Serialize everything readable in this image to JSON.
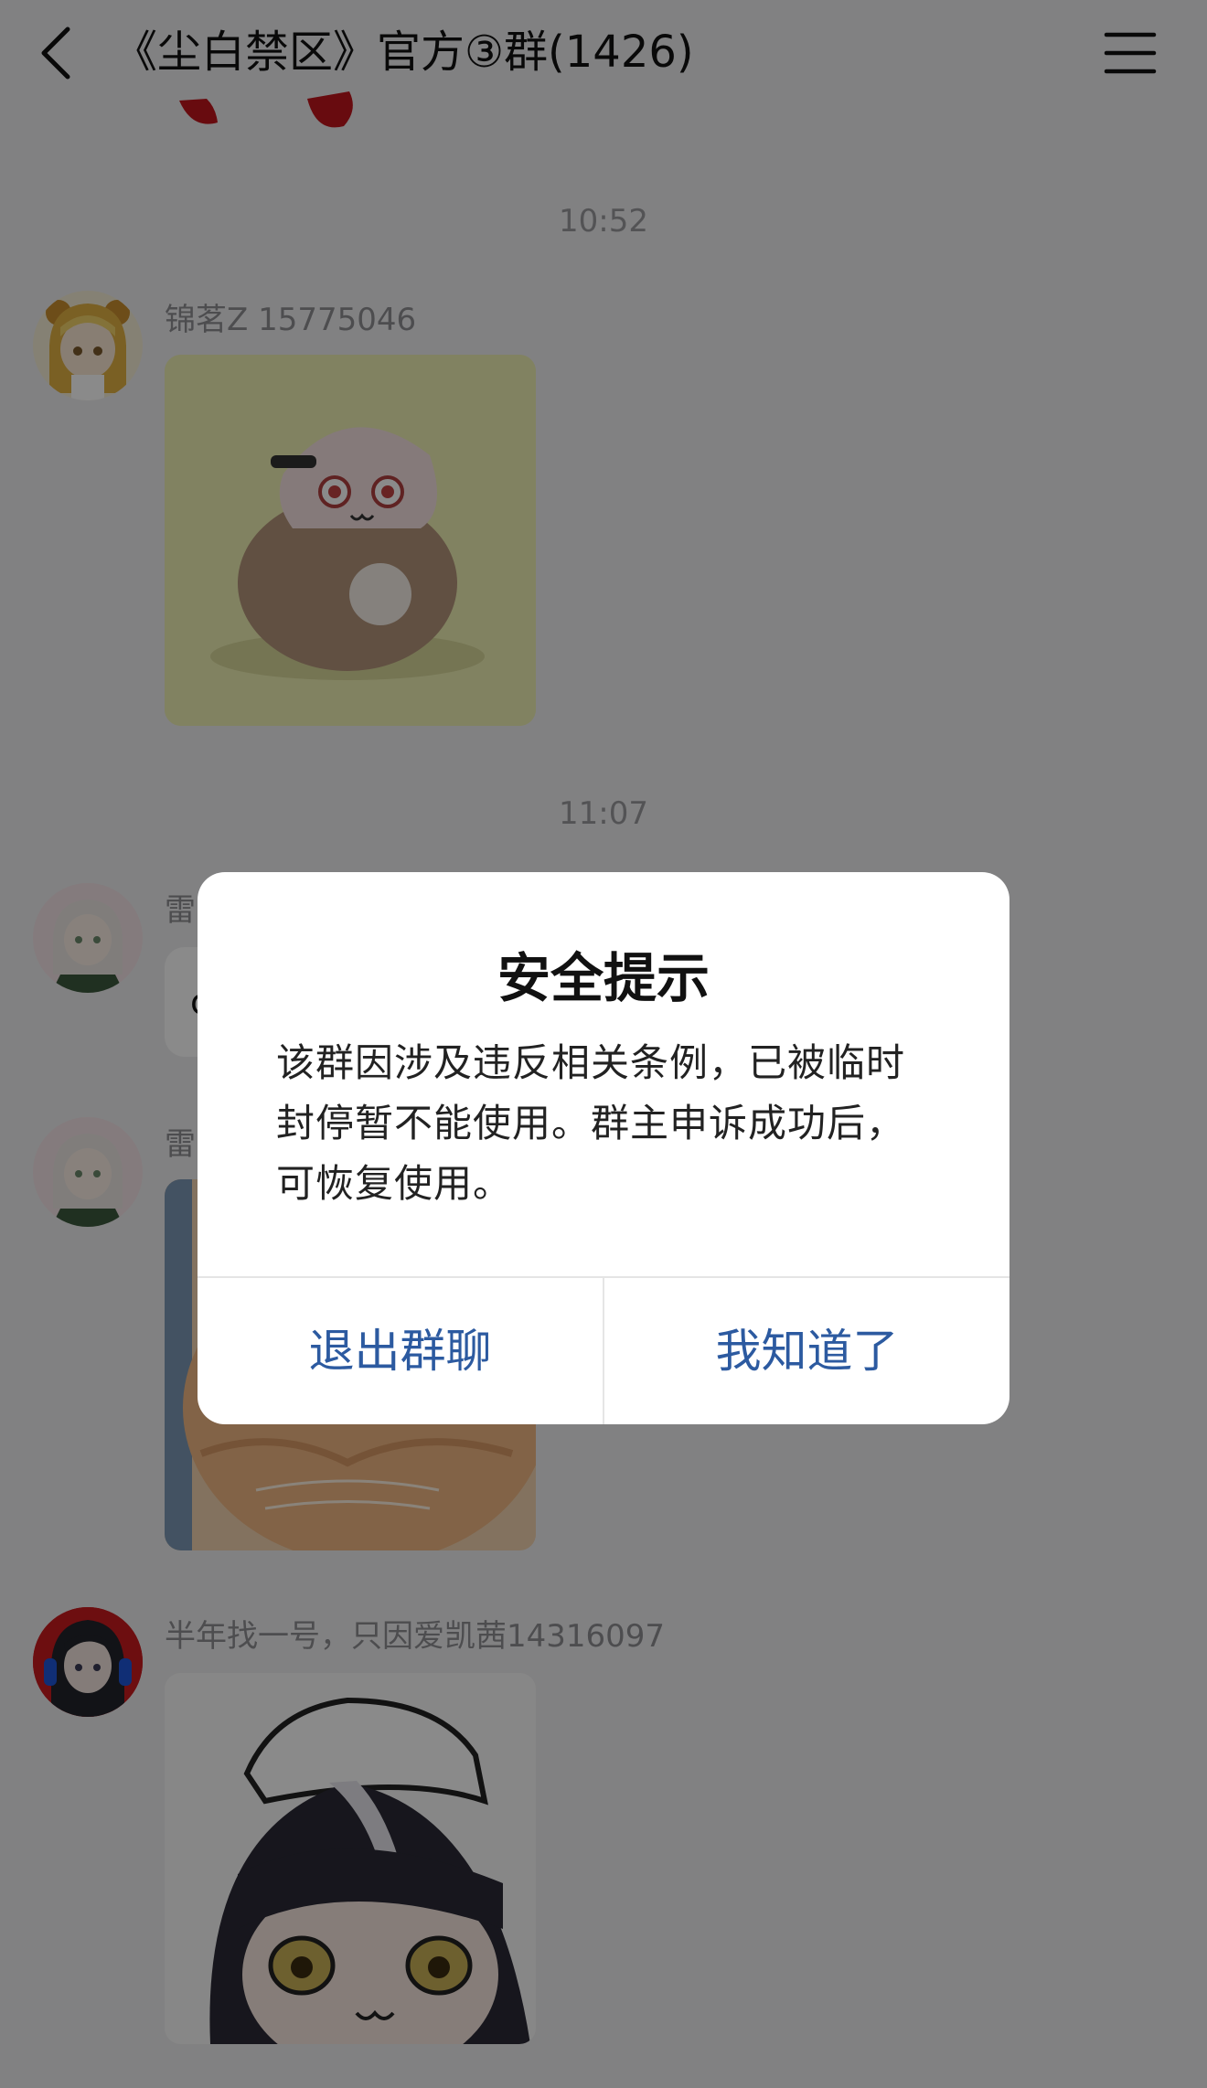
{
  "header": {
    "title": "《尘白禁区》官方③群(1426)",
    "back_icon": "chevron-left-icon",
    "menu_icon": "hamburger-menu-icon"
  },
  "messages": [
    {
      "timestamp": "10:52",
      "sender": "锦茗Z  15775046",
      "type": "image",
      "image_desc": "sticker"
    },
    {
      "timestamp": "11:07",
      "sender": "雷",
      "type": "text",
      "text_partial": "c"
    },
    {
      "sender": "雷",
      "type": "image",
      "image_desc": "cat photo"
    },
    {
      "sender": "半年找一号，只因爱凯茜14316097",
      "type": "image",
      "image_desc": "sticker"
    }
  ],
  "dialog": {
    "title": "安全提示",
    "message": "该群因涉及违反相关条例，已被临时封停暂不能使用。群主申诉成功后，可恢复使用。",
    "buttons": {
      "exit": "退出群聊",
      "ok": "我知道了"
    },
    "button_color": "#2c5aa0"
  },
  "colors": {
    "background": "#efeff0",
    "overlay": "rgba(0,0,0,0.46)",
    "timestamp": "#9a9a9e",
    "sender": "#8e8e93"
  }
}
